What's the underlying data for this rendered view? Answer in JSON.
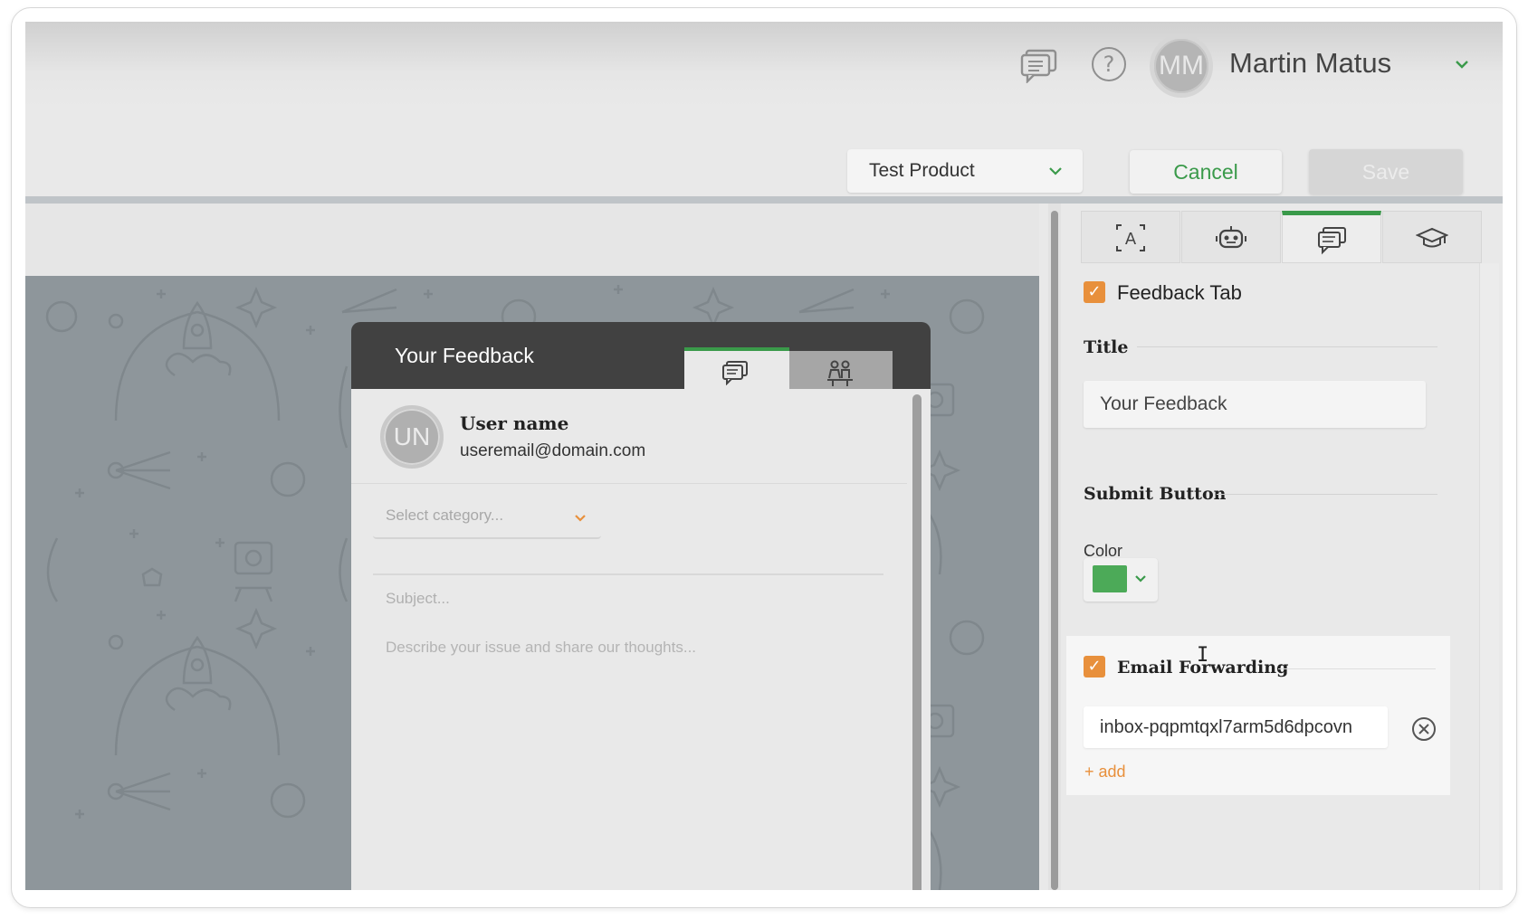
{
  "header": {
    "user_initials": "MM",
    "user_name": "Martin Matus"
  },
  "toolbar": {
    "product_select": "Test Product",
    "cancel_label": "Cancel",
    "save_label": "Save"
  },
  "widget": {
    "title": "Your Feedback",
    "tabs": [
      {
        "icon": "feedback-icon",
        "active": true
      },
      {
        "icon": "people-icon",
        "active": false
      }
    ],
    "user_initials": "UN",
    "user_name": "User name",
    "user_email": "useremail@domain.com",
    "category_placeholder": "Select category...",
    "subject_placeholder": "Subject...",
    "description_placeholder": "Describe your issue and share our thoughts..."
  },
  "panel": {
    "tabs": [
      {
        "icon": "text-frame-icon",
        "active": false
      },
      {
        "icon": "robot-icon",
        "active": false
      },
      {
        "icon": "feedback-icon",
        "active": true
      },
      {
        "icon": "graduation-cap-icon",
        "active": false
      }
    ],
    "feedback_tab_label": "Feedback Tab",
    "feedback_tab_checked": true,
    "title_section": "Title",
    "title_value": "Your Feedback",
    "submit_section": "Submit Button",
    "color_label": "Color",
    "submit_color": "#4caa58",
    "email_forwarding_label": "Email Forwarding",
    "email_forwarding_checked": true,
    "email_value": "inbox-pqpmtqxl7arm5d6dpcovn",
    "add_label": "+ add"
  },
  "colors": {
    "accent_green": "#3a9a4a",
    "checkbox_orange": "#e8903c"
  }
}
